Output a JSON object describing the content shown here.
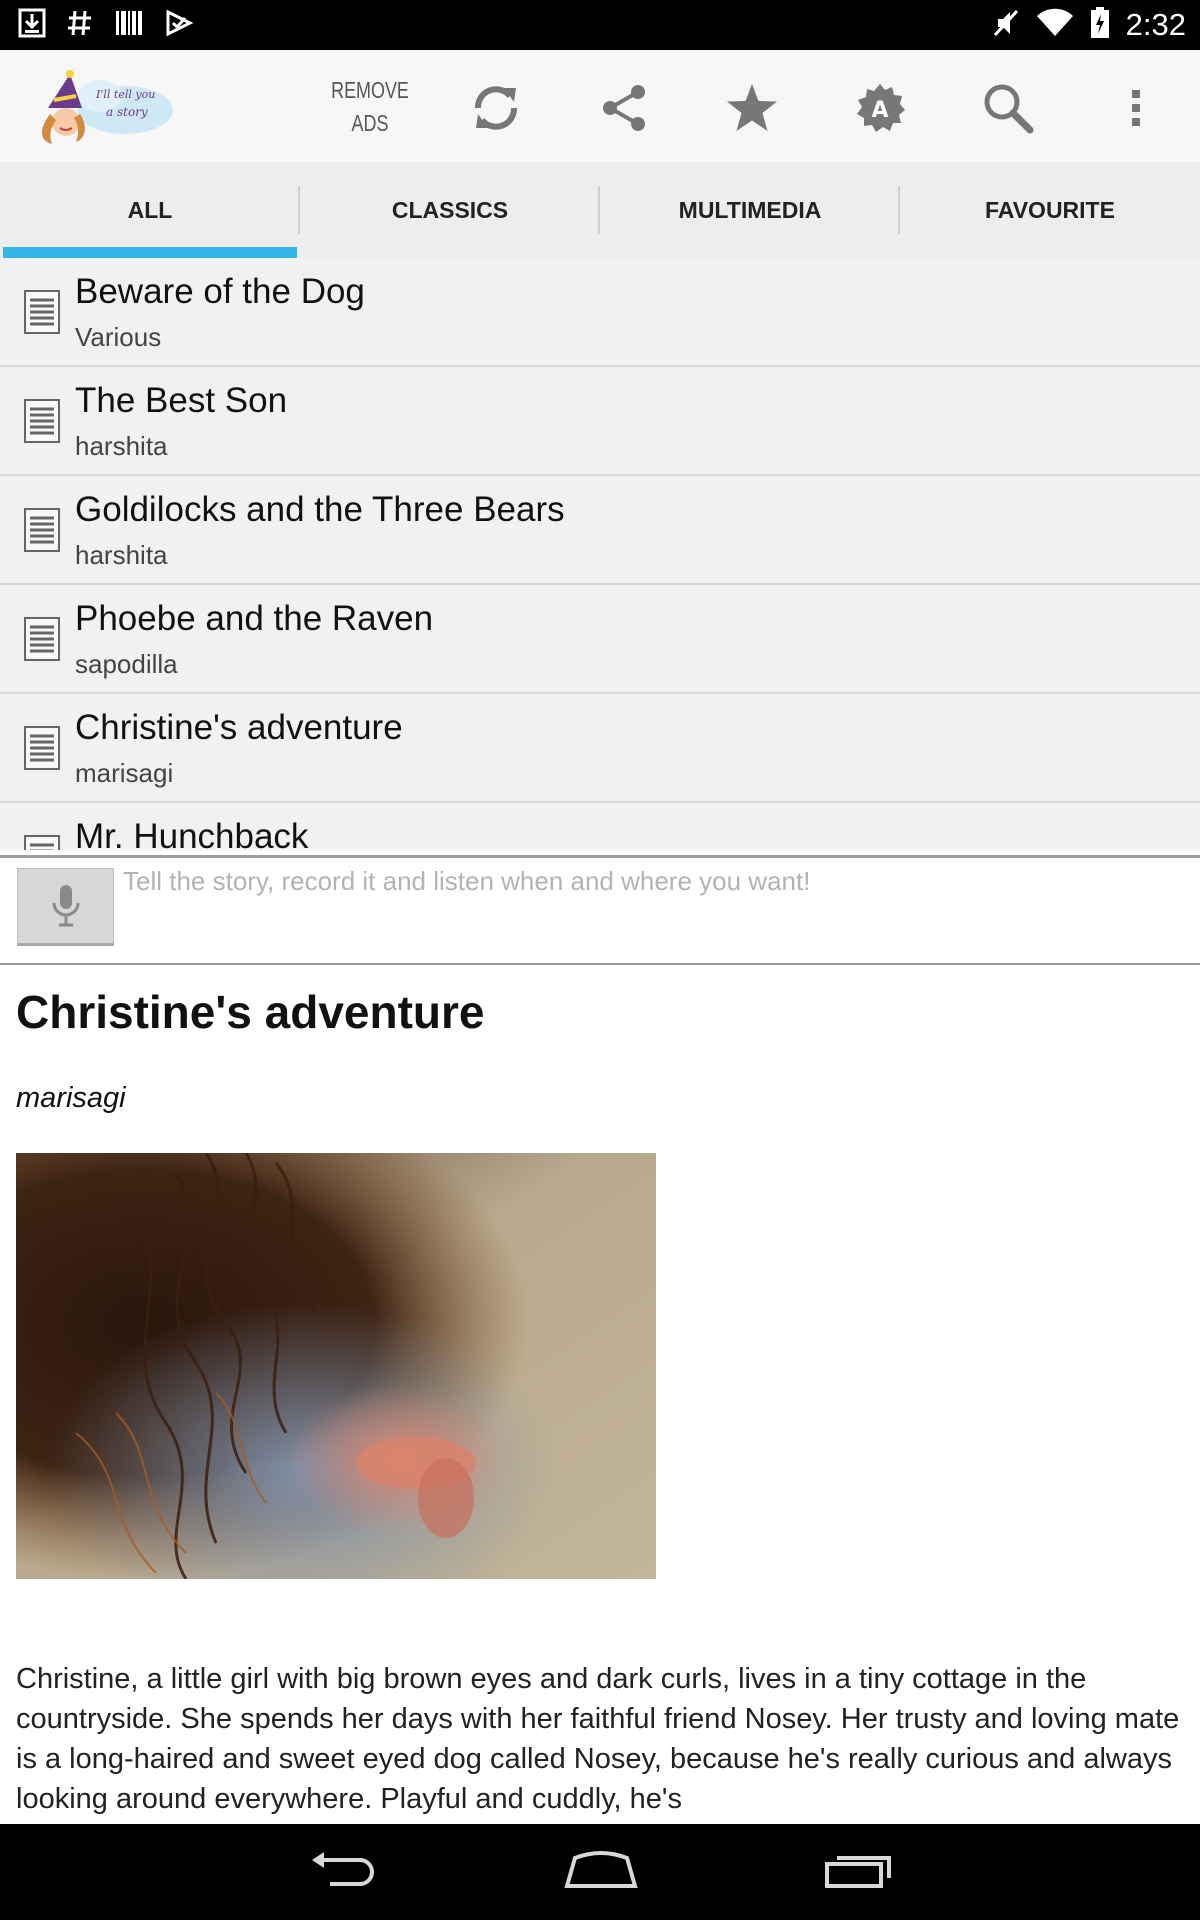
{
  "status_bar": {
    "time": "2:32",
    "left_icons": [
      "download-icon",
      "hash-icon",
      "barcode-icon",
      "check-flag-icon"
    ],
    "right_icons": [
      "mute-icon",
      "wifi-icon",
      "battery-icon"
    ]
  },
  "action_bar": {
    "logo_text_line1": "I'll tell you",
    "logo_text_line2": "a story",
    "remove_ads_line1": "REMOVE",
    "remove_ads_line2": "ADS",
    "icons": [
      "refresh-icon",
      "share-icon",
      "star-icon",
      "settings-badge-icon",
      "search-icon",
      "overflow-menu-icon"
    ]
  },
  "tabs": [
    {
      "label": "ALL",
      "selected": true
    },
    {
      "label": "CLASSICS",
      "selected": false
    },
    {
      "label": "MULTIMEDIA",
      "selected": false
    },
    {
      "label": "FAVOURITE",
      "selected": false
    }
  ],
  "stories": [
    {
      "title": "Beware of the Dog",
      "author": "Various"
    },
    {
      "title": "The Best Son",
      "author": "harshita"
    },
    {
      "title": "Goldilocks and the Three Bears",
      "author": "harshita"
    },
    {
      "title": "Phoebe and the Raven",
      "author": "sapodilla"
    },
    {
      "title": "Christine's adventure",
      "author": "marisagi"
    },
    {
      "title": "Mr. Hunchback",
      "author": ""
    }
  ],
  "record": {
    "hint": "Tell the story, record it and listen when and where you want!"
  },
  "article": {
    "title": "Christine's adventure",
    "author": "marisagi",
    "image": "girl-with-curly-hair-photo",
    "body": "Christine, a little girl with big brown eyes and dark curls, lives in a tiny cottage in the countryside. She spends her days with her faithful friend Nosey. Her trusty and loving mate is a long-haired and sweet eyed dog called Nosey, because he's really curious and always looking around everywhere. Playful and cuddly, he's"
  },
  "nav_bar": {
    "buttons": [
      "back-icon",
      "home-icon",
      "recent-apps-icon"
    ]
  },
  "colors": {
    "accent": "#33b5e5",
    "status_bar": "#000000",
    "action_bar": "#f7f7f7",
    "tab_bar": "#ededed",
    "list_item": "#f1f1f1"
  }
}
